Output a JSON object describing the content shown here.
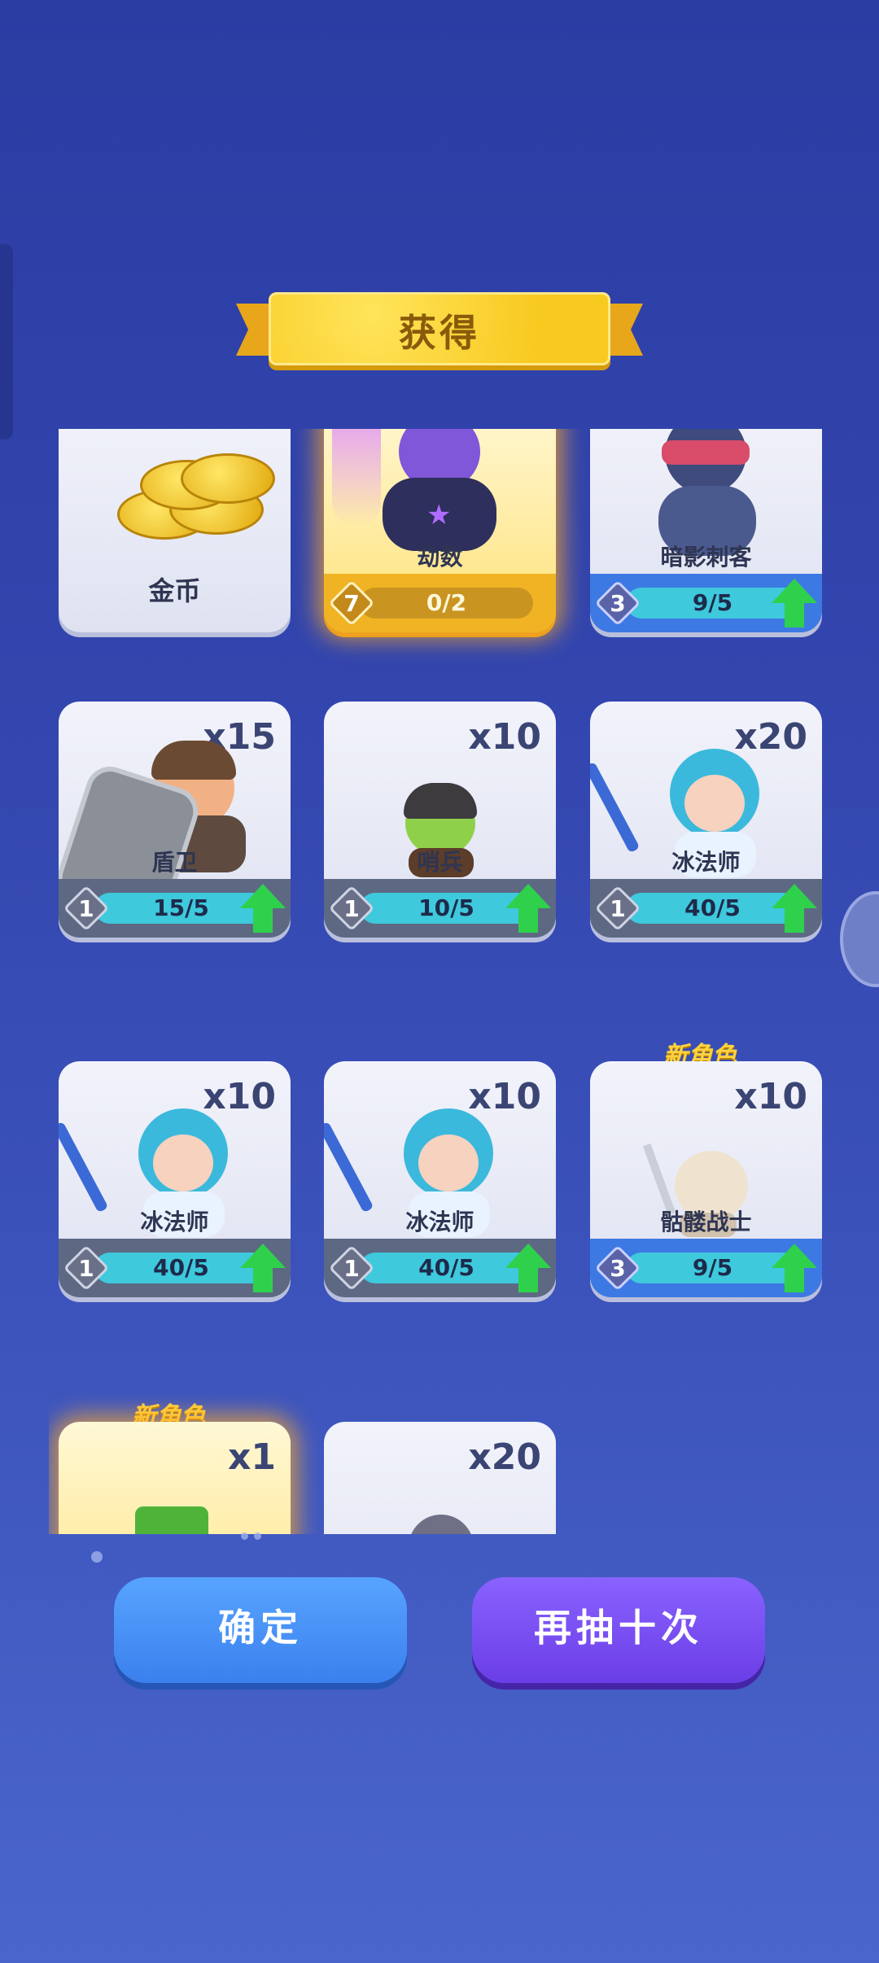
{
  "header": {
    "title": "获得"
  },
  "cards": [
    {
      "name": "金币",
      "count": "",
      "style": "plain"
    },
    {
      "name": "劫数",
      "count": "",
      "style": "gold",
      "level": "7",
      "progress": "0/2"
    },
    {
      "name": "暗影刺客",
      "count": "",
      "style": "blue",
      "level": "3",
      "progress": "9/5"
    },
    {
      "name": "盾卫",
      "count": "x15",
      "style": "grey",
      "level": "1",
      "progress": "15/5"
    },
    {
      "name": "哨兵",
      "count": "x10",
      "style": "grey",
      "level": "1",
      "progress": "10/5"
    },
    {
      "name": "冰法师",
      "count": "x20",
      "style": "grey",
      "level": "1",
      "progress": "40/5"
    },
    {
      "name": "冰法师",
      "count": "x10",
      "style": "grey",
      "level": "1",
      "progress": "40/5"
    },
    {
      "name": "冰法师",
      "count": "x10",
      "style": "grey",
      "level": "1",
      "progress": "40/5"
    },
    {
      "name": "骷髅战士",
      "count": "x10",
      "style": "blue",
      "level": "3",
      "progress": "9/5",
      "badge": "新角色"
    },
    {
      "name": "",
      "count": "x1",
      "style": "gold",
      "badge": "新角色"
    },
    {
      "name": "",
      "count": "x20",
      "style": "plain"
    }
  ],
  "buttons": {
    "confirm": "确定",
    "redraw": "再抽十次"
  }
}
